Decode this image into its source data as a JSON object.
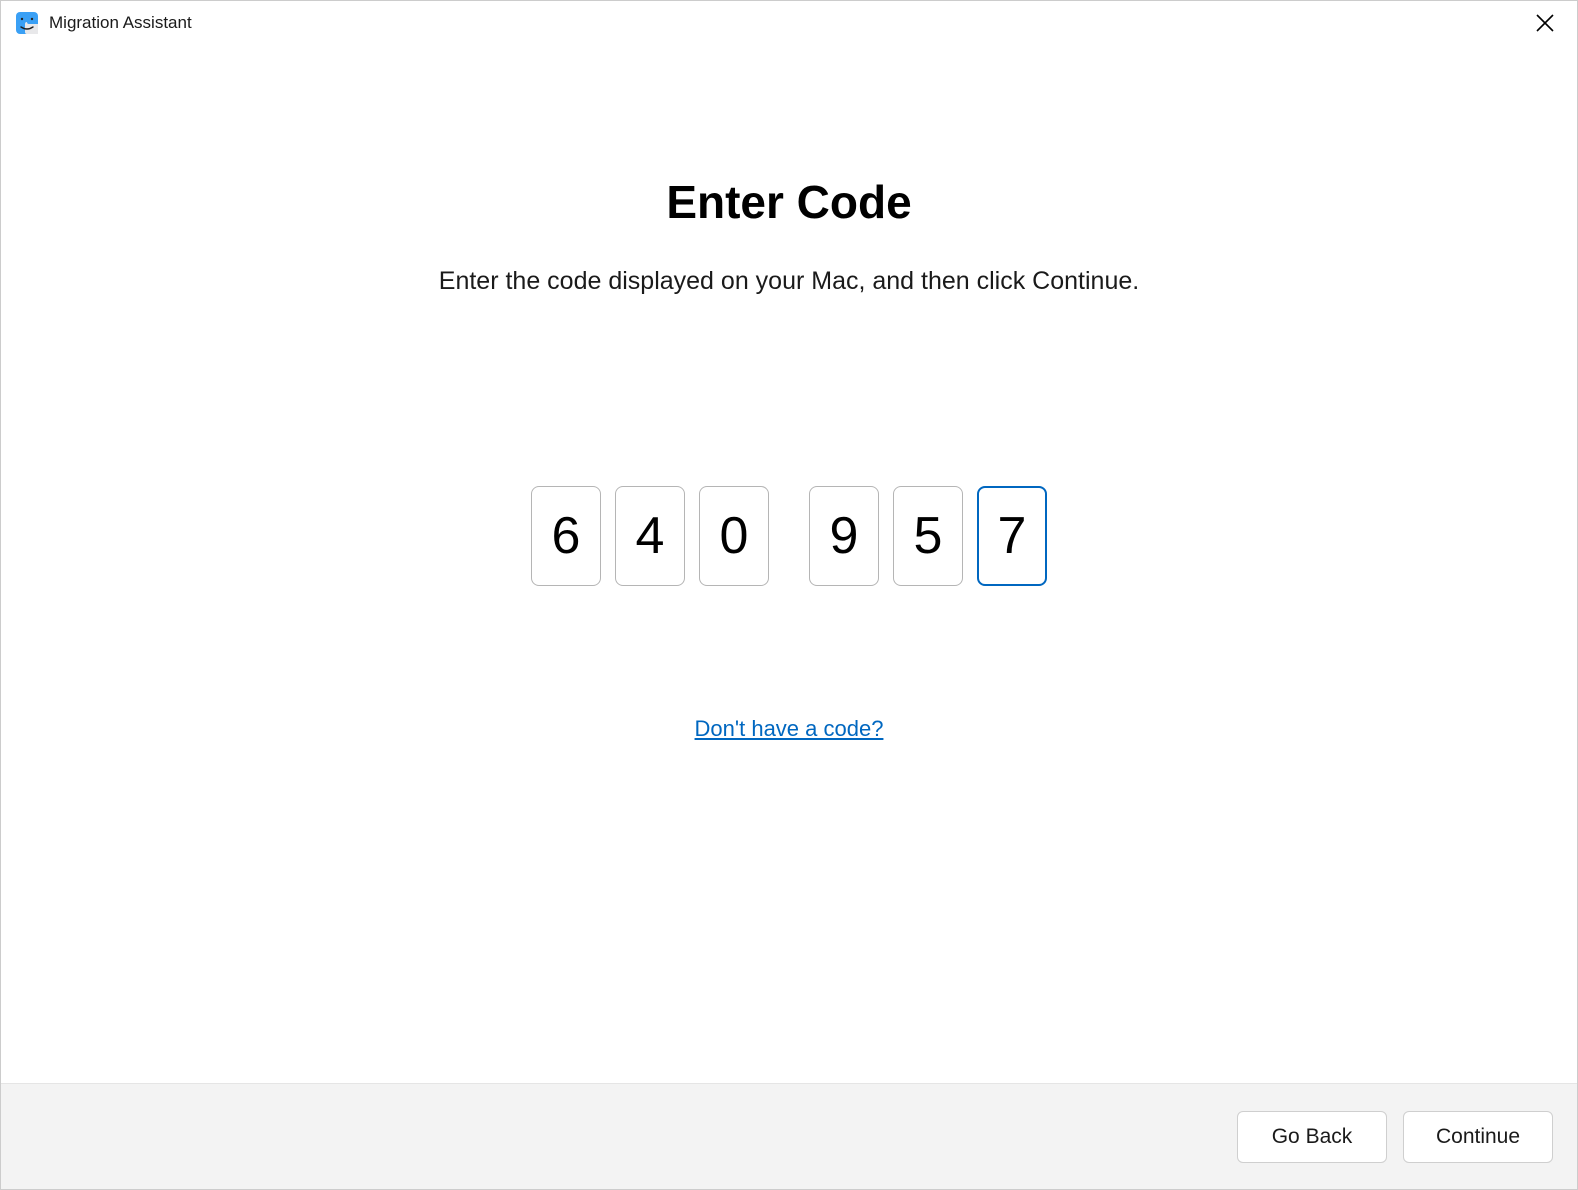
{
  "window": {
    "title": "Migration Assistant"
  },
  "main": {
    "heading": "Enter Code",
    "instruction": "Enter the code displayed on your Mac, and then click Continue.",
    "code_digits": [
      "6",
      "4",
      "0",
      "9",
      "5",
      "7"
    ],
    "active_index": 5,
    "help_link": "Don't have a code?"
  },
  "footer": {
    "go_back": "Go Back",
    "continue": "Continue"
  },
  "icons": {
    "app": "finder-icon",
    "close": "close-icon"
  }
}
